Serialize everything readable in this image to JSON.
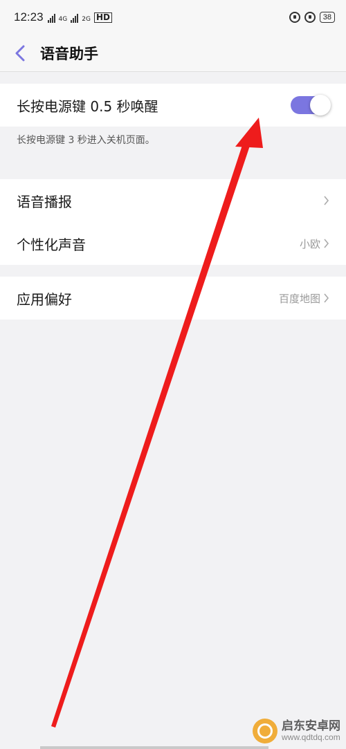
{
  "status_bar": {
    "time": "12:23",
    "network_1": "4G",
    "network_2": "2G",
    "hd": "HD",
    "battery": "38"
  },
  "header": {
    "back_icon": "chevron-left-icon",
    "title": "语音助手"
  },
  "power_key": {
    "label": "长按电源键 0.5 秒唤醒",
    "toggle_on": true,
    "description": "长按电源键 3 秒进入关机页面。"
  },
  "voice_settings": [
    {
      "label": "语音播报",
      "value": ""
    },
    {
      "label": "个性化声音",
      "value": "小欧"
    }
  ],
  "app_prefs": {
    "label": "应用偏好",
    "value": "百度地图"
  },
  "watermark": {
    "name": "启东安卓网",
    "url": "www.qdtdq.com"
  },
  "colors": {
    "accent": "#7b76e0",
    "annotation_arrow": "#ee1c1c",
    "background": "#f2f2f4"
  }
}
